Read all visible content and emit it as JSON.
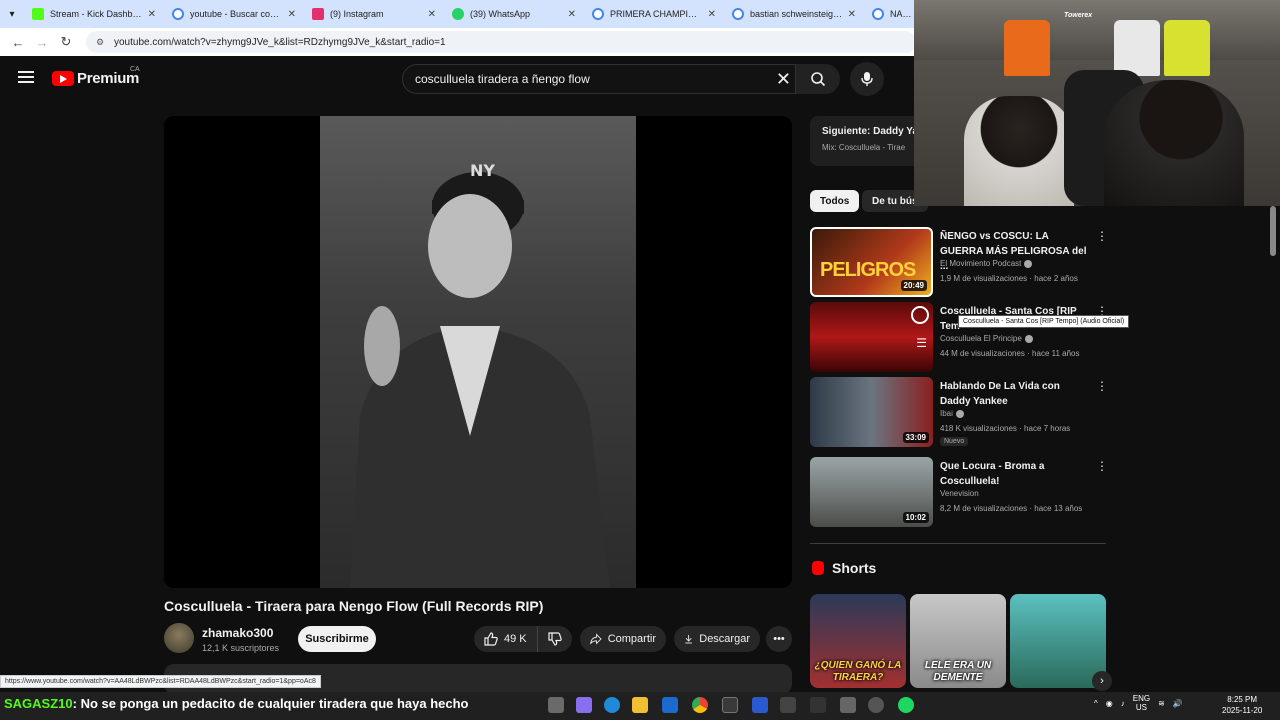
{
  "browser": {
    "tabs": [
      {
        "label": "Stream - Kick Dashboard",
        "color": "#53fc18"
      },
      {
        "label": "youtube - Buscar con Google",
        "color": "#4285f4"
      },
      {
        "label": "(9) Instagram",
        "color": "#e1306c"
      },
      {
        "label": "(39) WhatsApp",
        "color": "#25d366"
      },
      {
        "label": "PRIMERA CHAMPIONS DE",
        "color": "#4285f4"
      },
      {
        "label": "bastian schweinsteiger - B",
        "color": "#4285f4"
      },
      {
        "label": "NACIONA",
        "color": "#4285f4"
      }
    ],
    "url": "youtube.com/watch?v=zhymg9JVe_k&list=RDzhymg9JVe_k&start_radio=1",
    "status_url": "https://www.youtube.com/watch?v=AA48LdBWPzc&list=RDAA48LdBWPzc&start_radio=1&pp=oAc8"
  },
  "header": {
    "logo_text": "Premium",
    "region": "CA",
    "search_query": "cosculluela tiradera a ñengo flow"
  },
  "video": {
    "title": "Cosculluela - Tiraera para Nengo Flow (Full Records RIP)",
    "channel": "zhamako300",
    "subscribers": "12,1 K suscriptores",
    "subscribe_label": "Suscribirme",
    "likes": "49 K",
    "share_label": "Compartir",
    "download_label": "Descargar"
  },
  "upnext": {
    "title": "Siguiente: Daddy Ya",
    "subtitle": "Mix: Cosculluela - Tirae"
  },
  "chips": [
    "Todos",
    "De tu bús"
  ],
  "recommendations": [
    {
      "title": "ÑENGO vs COSCU: LA GUERRA MÁS PELIGROSA del ...",
      "channel": "El Movimiento Podcast",
      "verified": true,
      "views": "1,9 M de visualizaciones",
      "age": "hace 2 años",
      "duration": "20:49",
      "thumb_text": "PELIGROS",
      "badge": ""
    },
    {
      "title": "Cosculluela - Santa Cos [RIP Tem",
      "channel": "Cosculluela El Principe",
      "verified": true,
      "views": "44 M de visualizaciones",
      "age": "hace 11 años",
      "duration": "",
      "thumb_text": "",
      "badge": ""
    },
    {
      "title": "Hablando De La Vida con Daddy Yankee",
      "channel": "Ibai",
      "verified": true,
      "views": "418 K visualizaciones",
      "age": "hace 7 horas",
      "duration": "33:09",
      "thumb_text": "",
      "badge": "Nuevo"
    },
    {
      "title": "Que Locura - Broma a Cosculluela!",
      "channel": "Venevision",
      "verified": false,
      "views": "8,2 M de visualizaciones",
      "age": "hace 13 años",
      "duration": "10:02",
      "thumb_text": "",
      "badge": ""
    }
  ],
  "tooltip": "Cosculluela - Santa Cos [RIP Tempo] (Audio Oficial)",
  "shorts": {
    "heading": "Shorts",
    "items": [
      {
        "caption": "¿QUIEN GANÓ LA TIRAERA?"
      },
      {
        "caption": "LELE ERA UN DEMENTE"
      },
      {
        "caption": ""
      }
    ]
  },
  "webcam": {
    "logo": "Towerex"
  },
  "chat": {
    "user": "SAGASZ10",
    "message": ": No se ponga un pedacito de cualquier tiradera que haya hecho"
  },
  "tray": {
    "lang1": "ENG",
    "lang2": "US",
    "time": "8:25 PM",
    "date": "2025-11-20"
  }
}
